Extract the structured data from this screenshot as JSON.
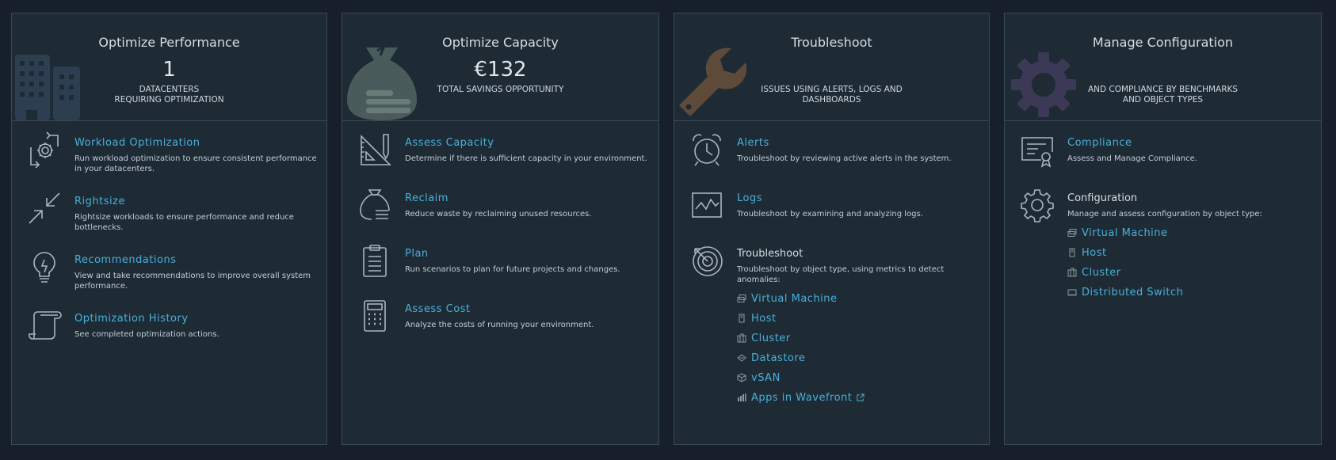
{
  "cards": [
    {
      "title": "Optimize Performance",
      "stat": "1",
      "subtitle": [
        "DATACENTERS",
        "REQUIRING OPTIMIZATION"
      ],
      "items": [
        {
          "title": "Workload Optimization",
          "desc": "Run workload optimization to ensure consistent performance in your datacenters.",
          "icon": "workload-optimization-icon"
        },
        {
          "title": "Rightsize",
          "desc": "Rightsize workloads to ensure performance and reduce bottlenecks.",
          "icon": "rightsize-icon"
        },
        {
          "title": "Recommendations",
          "desc": "View and take recommendations to improve overall system performance.",
          "icon": "lightbulb-icon"
        },
        {
          "title": "Optimization History",
          "desc": "See completed optimization actions.",
          "icon": "scroll-icon"
        }
      ]
    },
    {
      "title": "Optimize Capacity",
      "stat": "€132",
      "subtitle": [
        "TOTAL SAVINGS OPPORTUNITY"
      ],
      "items": [
        {
          "title": "Assess Capacity",
          "desc": "Determine if there is sufficient capacity in your environment.",
          "icon": "ruler-pencil-icon"
        },
        {
          "title": "Reclaim",
          "desc": "Reduce waste by reclaiming unused resources.",
          "icon": "money-bag-icon"
        },
        {
          "title": "Plan",
          "desc": "Run scenarios to plan for future projects and changes.",
          "icon": "clipboard-icon"
        },
        {
          "title": "Assess Cost",
          "desc": "Analyze the costs of running your environment.",
          "icon": "calculator-icon"
        }
      ]
    },
    {
      "title": "Troubleshoot",
      "subtitle": [
        "ISSUES USING ALERTS, LOGS AND",
        "DASHBOARDS"
      ],
      "items": [
        {
          "title": "Alerts",
          "desc": "Troubleshoot by reviewing active alerts in the system.",
          "icon": "alarm-clock-icon"
        },
        {
          "title": "Logs",
          "desc": "Troubleshoot by examining and analyzing logs.",
          "icon": "log-chart-icon"
        },
        {
          "title": "Troubleshoot",
          "desc": "Troubleshoot by object type, using metrics to detect anomalies:",
          "icon": "target-icon"
        }
      ],
      "links": [
        {
          "label": "Virtual Machine",
          "icon": "virtual-machine-icon"
        },
        {
          "label": "Host",
          "icon": "host-icon"
        },
        {
          "label": "Cluster",
          "icon": "cluster-icon"
        },
        {
          "label": "Datastore",
          "icon": "datastore-icon"
        },
        {
          "label": "vSAN",
          "icon": "vsan-icon"
        },
        {
          "label": "Apps in Wavefront",
          "icon": "wavefront-icon"
        }
      ]
    },
    {
      "title": "Manage Configuration",
      "subtitle": [
        "AND COMPLIANCE BY BENCHMARKS",
        "AND OBJECT TYPES"
      ],
      "items": [
        {
          "title": "Compliance",
          "desc": "Assess and Manage Compliance.",
          "icon": "certificate-icon"
        },
        {
          "title": "Configuration",
          "desc": "Manage and assess configuration by object type:",
          "icon": "gear-icon"
        }
      ],
      "links": [
        {
          "label": "Virtual Machine",
          "icon": "virtual-machine-icon"
        },
        {
          "label": "Host",
          "icon": "host-icon"
        },
        {
          "label": "Cluster",
          "icon": "cluster-icon"
        },
        {
          "label": "Distributed Switch",
          "icon": "distributed-switch-icon"
        }
      ]
    }
  ],
  "colors": {
    "background": "#17202a",
    "card": "#1e2b35",
    "border": "#3a4853",
    "link": "#49afd9",
    "icon": "#aab4bd"
  }
}
